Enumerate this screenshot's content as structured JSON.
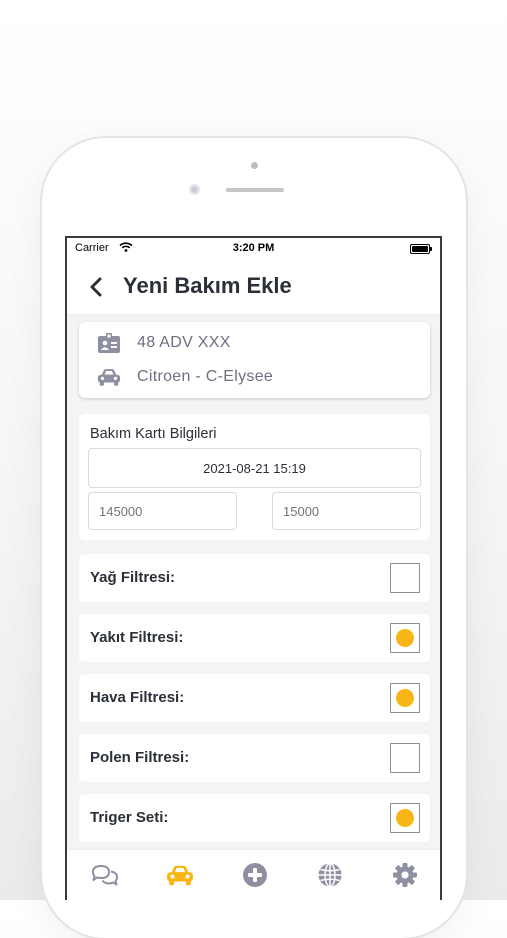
{
  "status_bar": {
    "carrier": "Carrier",
    "time": "3:20 PM"
  },
  "nav": {
    "title": "Yeni Bakım Ekle",
    "back_icon": "chevron-left-icon"
  },
  "vehicle": {
    "plate": "48 ADV XXX",
    "model": "Citroen - C-Elysee"
  },
  "maintenance_card": {
    "title": "Bakım Kartı Bilgileri",
    "date_value": "2021-08-21 15:19",
    "current_km_placeholder": "145000",
    "next_km_placeholder": "15000"
  },
  "filters": [
    {
      "label": "Yağ Filtresi:",
      "checked": false
    },
    {
      "label": "Yakıt Filtresi:",
      "checked": true
    },
    {
      "label": "Hava Filtresi:",
      "checked": true
    },
    {
      "label": "Polen Filtresi:",
      "checked": false
    },
    {
      "label": "Triger Seti:",
      "checked": true
    }
  ],
  "tabs": [
    {
      "icon": "chat-bubbles-icon",
      "active": false
    },
    {
      "icon": "car-icon",
      "active": true
    },
    {
      "icon": "add-circle-icon",
      "active": false
    },
    {
      "icon": "globe-icon",
      "active": false
    },
    {
      "icon": "gear-icon",
      "active": false
    }
  ],
  "colors": {
    "accent": "#f7b614",
    "icon_inactive": "#8e90a2",
    "text_dark": "#2b2f3a",
    "text_muted": "#6d7083"
  }
}
